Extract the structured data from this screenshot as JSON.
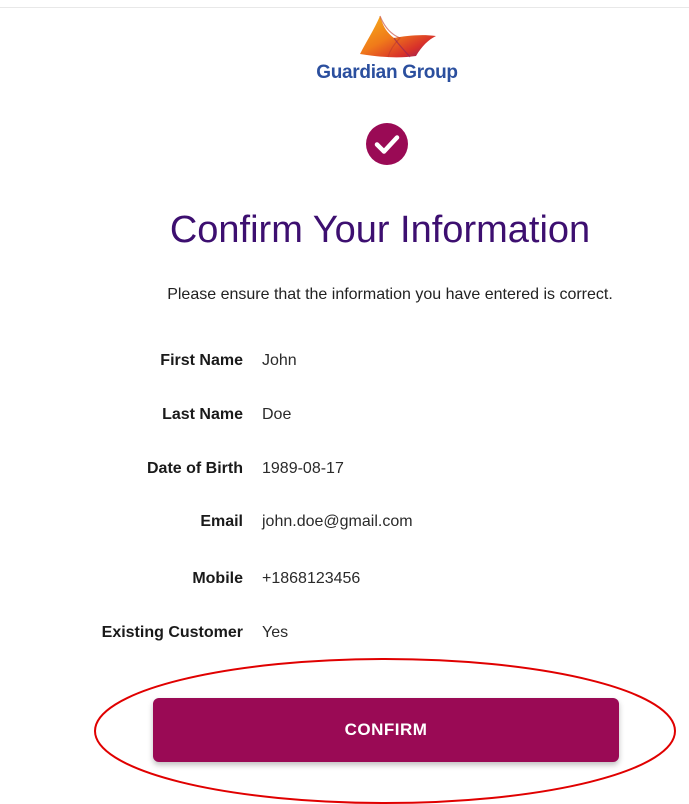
{
  "brand": {
    "name": "Guardian Group",
    "logo_icon": "guardian-flame-logo",
    "text_color": "#2b4f9e"
  },
  "status": {
    "icon": "check-circle-icon",
    "color": "#9a0a55"
  },
  "header": {
    "title": "Confirm Your Information",
    "subtitle": "Please ensure that the information you have entered is correct.",
    "title_color": "#3d0f70"
  },
  "details": [
    {
      "label": "First Name",
      "value": "John"
    },
    {
      "label": "Last Name",
      "value": "Doe"
    },
    {
      "label": "Date of Birth",
      "value": "1989-08-17"
    },
    {
      "label": "Email",
      "value": "john.doe@gmail.com"
    },
    {
      "label": "Mobile",
      "value": "+1868123456"
    },
    {
      "label": "Existing Customer",
      "value": "Yes"
    }
  ],
  "actions": {
    "confirm_label": "CONFIRM",
    "confirm_color": "#9a0a55"
  },
  "annotation": {
    "shape": "ellipse",
    "color": "#e00000",
    "highlights": "confirm-button"
  }
}
